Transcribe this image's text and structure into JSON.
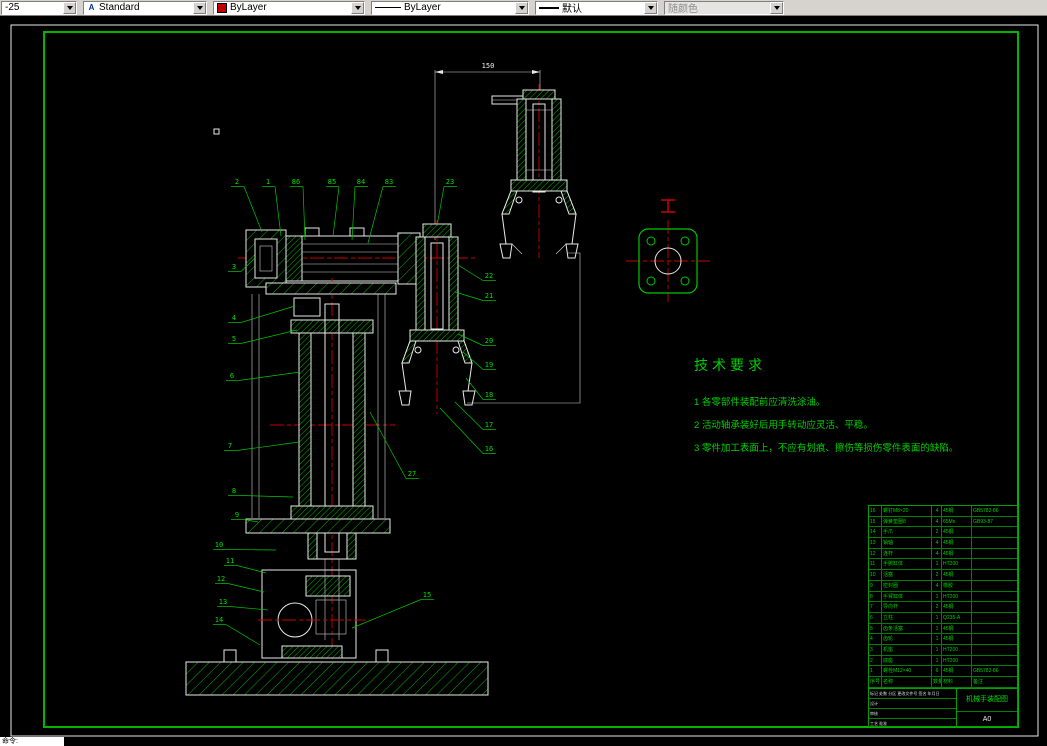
{
  "toolbar": {
    "dimstyle": "-25",
    "textstyle": "Standard",
    "color": "ByLayer",
    "linetype": "ByLayer",
    "lineweight": "默认",
    "plotstyle": "随颜色"
  },
  "command_line": "命令:",
  "drawing": {
    "dimension_150": "150",
    "tech_requirements": {
      "title": "技术要求",
      "items": [
        "1  各零部件装配前应清洗涂油。",
        "2  活动轴承装好后用手转动应灵活、平稳。",
        "3  零件加工表面上，不应有划痕、擦伤等损伤零件表面的缺陷。"
      ]
    },
    "callouts": [
      "2",
      "1",
      "86",
      "85",
      "84",
      "83",
      "23",
      "22",
      "21",
      "20",
      "19",
      "18",
      "17",
      "16",
      "3",
      "4",
      "5",
      "6",
      "7",
      "8",
      "9",
      "10",
      "11",
      "12",
      "13",
      "14",
      "15",
      "27"
    ],
    "bom": {
      "header": [
        "序号",
        "名称",
        "数量",
        "材料",
        "备注"
      ],
      "rows": [
        {
          "seq": "16",
          "name": "螺钉M8×20",
          "qty": "4",
          "material": "45钢",
          "note": "GB5782-86"
        },
        {
          "seq": "15",
          "name": "弹簧垫圈8",
          "qty": "4",
          "material": "65Mn",
          "note": "GB93-87"
        },
        {
          "seq": "14",
          "name": "手爪",
          "qty": "2",
          "material": "45钢",
          "note": ""
        },
        {
          "seq": "13",
          "name": "销轴",
          "qty": "4",
          "material": "45钢",
          "note": ""
        },
        {
          "seq": "12",
          "name": "连杆",
          "qty": "4",
          "material": "45钢",
          "note": ""
        },
        {
          "seq": "11",
          "name": "手腕缸体",
          "qty": "1",
          "material": "HT200",
          "note": ""
        },
        {
          "seq": "10",
          "name": "活塞",
          "qty": "2",
          "material": "45钢",
          "note": ""
        },
        {
          "seq": "9",
          "name": "密封圈",
          "qty": "4",
          "material": "橡胶",
          "note": ""
        },
        {
          "seq": "8",
          "name": "手臂缸体",
          "qty": "1",
          "material": "HT200",
          "note": ""
        },
        {
          "seq": "7",
          "name": "导向杆",
          "qty": "2",
          "material": "45钢",
          "note": ""
        },
        {
          "seq": "6",
          "name": "立柱",
          "qty": "1",
          "material": "Q235-A",
          "note": ""
        },
        {
          "seq": "5",
          "name": "齿条活塞",
          "qty": "1",
          "material": "45钢",
          "note": ""
        },
        {
          "seq": "4",
          "name": "齿轮",
          "qty": "1",
          "material": "45钢",
          "note": ""
        },
        {
          "seq": "3",
          "name": "机座",
          "qty": "1",
          "material": "HT200",
          "note": ""
        },
        {
          "seq": "2",
          "name": "底座",
          "qty": "1",
          "material": "HT200",
          "note": ""
        },
        {
          "seq": "1",
          "name": "螺栓M12×40",
          "qty": "6",
          "material": "45钢",
          "note": "GB5782-86"
        }
      ]
    },
    "title_block": {
      "rows": [
        "标记 处数 分区 更改文件号 签名 年月日",
        "设计",
        "审核",
        "工艺  批准"
      ],
      "drawing_title": "机械手装配图",
      "sheet": "A0"
    }
  }
}
